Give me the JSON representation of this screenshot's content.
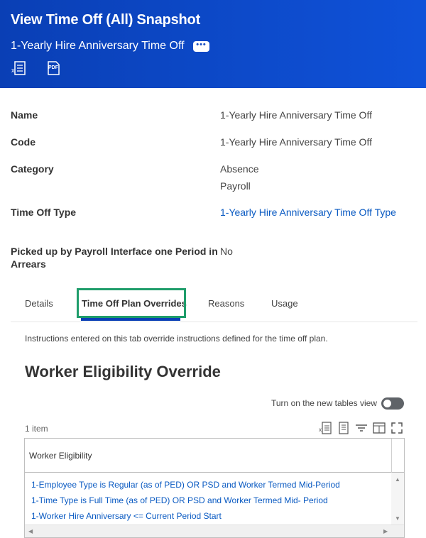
{
  "header": {
    "title": "View Time Off (All) Snapshot",
    "subtitle": "1-Yearly Hire Anniversary Time Off",
    "more_label": "•••",
    "icons": [
      "excel-export-icon",
      "pdf-export-icon"
    ],
    "pdf_label": "PDF",
    "bg_color": "#0f52d9"
  },
  "fields": {
    "name": {
      "label": "Name",
      "value": "1-Yearly Hire Anniversary Time Off"
    },
    "code": {
      "label": "Code",
      "value": "1-Yearly Hire Anniversary Time Off"
    },
    "category": {
      "label": "Category",
      "values": [
        "Absence",
        "Payroll"
      ]
    },
    "time_off_type": {
      "label": "Time Off Type",
      "value": "1-Yearly Hire Anniversary Time Off Type"
    },
    "payroll_interface": {
      "label_line1": "Picked up by Payroll Interface one Period in",
      "label_line2": "Arrears",
      "value": "No"
    }
  },
  "tabs": [
    {
      "label": "Details"
    },
    {
      "label": "Time Off Plan Overrides",
      "active": true
    },
    {
      "label": "Reasons"
    },
    {
      "label": "Usage"
    }
  ],
  "instructions": "Instructions entered on this tab override instructions defined for the time off plan.",
  "section_title": "Worker Eligibility Override",
  "toggle_label": "Turn on the new tables view",
  "item_count": "1 item",
  "grid": {
    "column": "Worker Eligibility",
    "rows": [
      "1-Employee Type is Regular (as of PED) OR PSD and Worker Termed Mid-Period",
      "1-Time Type is Full Time (as of PED) OR PSD and Worker Termed Mid- Period",
      "1-Worker Hire Anniversary <= Current Period Start"
    ]
  },
  "colors": {
    "link": "#0a5ac2",
    "active_tab_outline": "#1f9d6b",
    "tab_underline": "#0a3fb5"
  }
}
